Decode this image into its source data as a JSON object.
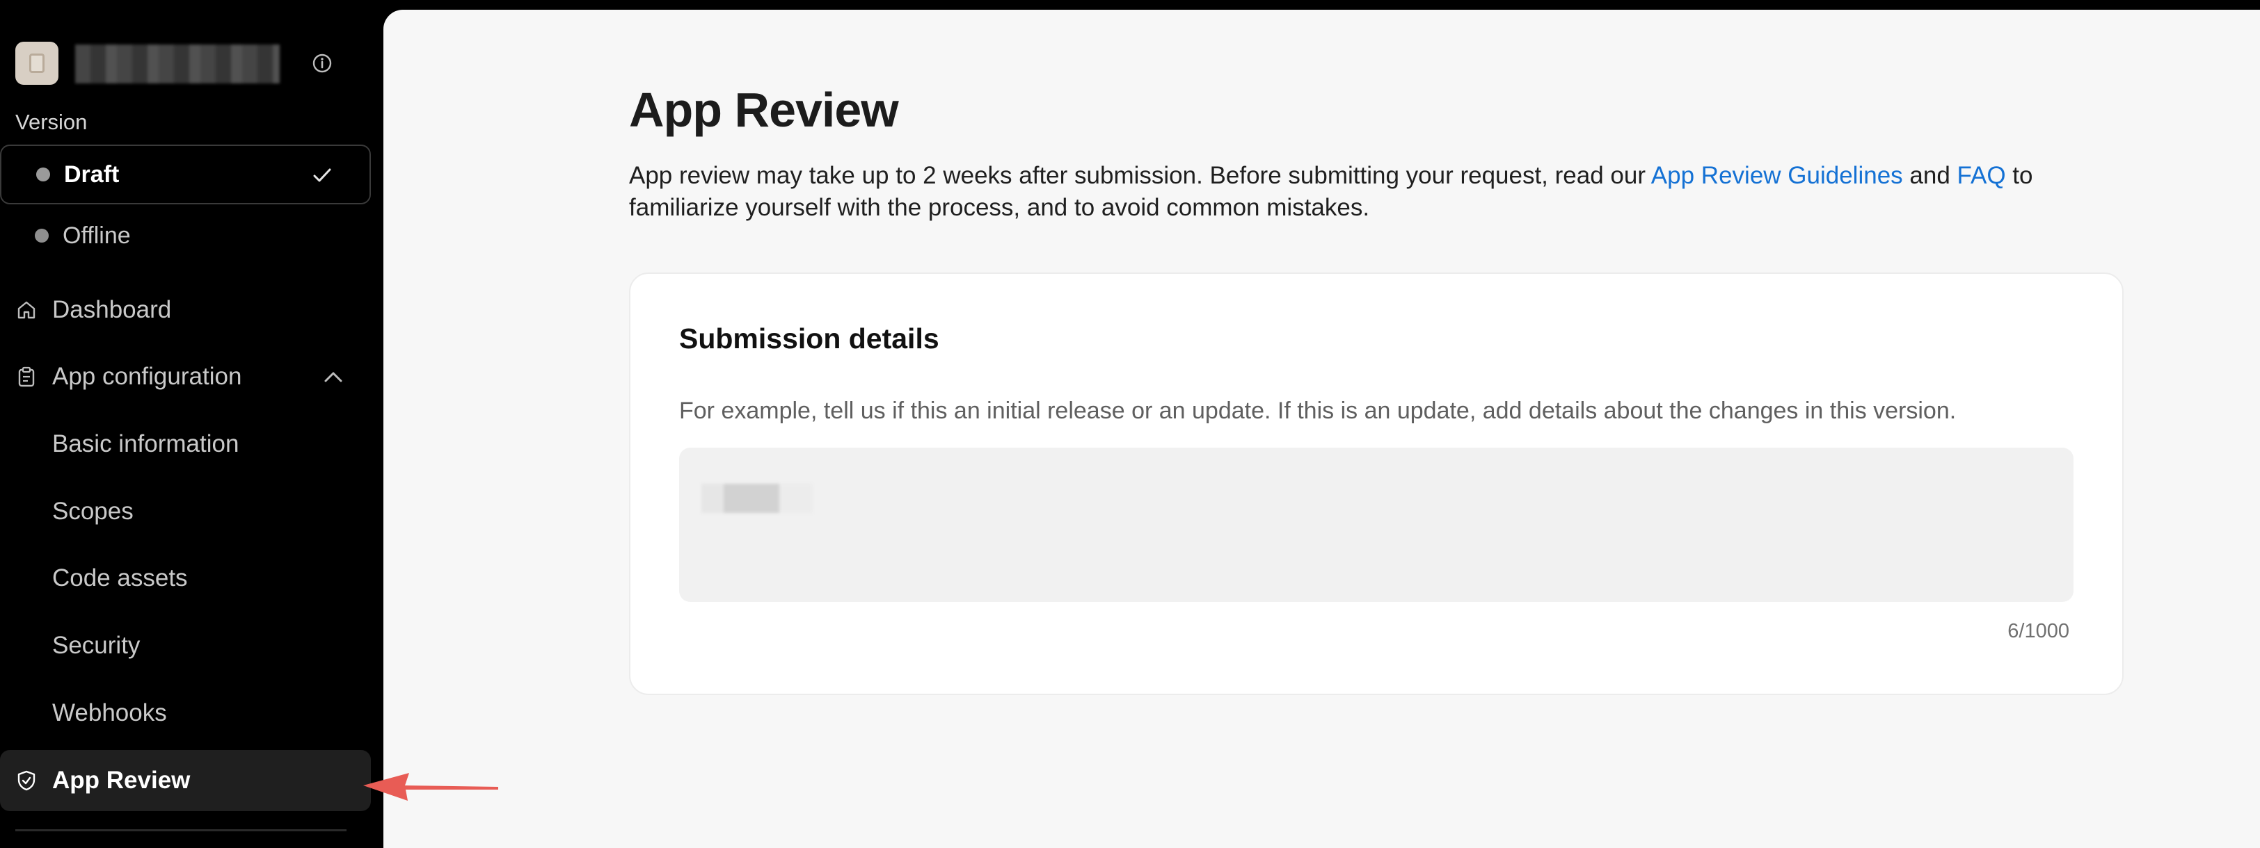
{
  "sidebar": {
    "app_avatar_icon": "app-logo",
    "info_icon": "info-icon",
    "version_label": "Version",
    "versions": [
      {
        "label": "Draft",
        "selected": true
      },
      {
        "label": "Offline",
        "selected": false
      }
    ],
    "nav": {
      "dashboard": "Dashboard",
      "app_configuration": "App configuration",
      "basic_information": "Basic information",
      "scopes": "Scopes",
      "code_assets": "Code assets",
      "security": "Security",
      "webhooks": "Webhooks",
      "app_review": "App Review"
    }
  },
  "main": {
    "title": "App Review",
    "description": {
      "before": "App review may take up to 2 weeks after submission. Before submitting your request, read our ",
      "link1": "App Review Guidelines",
      "middle": " and ",
      "link2": "FAQ",
      "after": " to familiarize yourself with the process, and to avoid common mistakes."
    },
    "card": {
      "title": "Submission details",
      "help": "For example, tell us if this an initial release or an update. If this is an update, add details about the changes in this version.",
      "char_count": "6/1000"
    }
  },
  "colors": {
    "sidebar_bg": "#000000",
    "main_bg": "#f7f7f7",
    "link": "#1471d4",
    "arrow": "#e85c55"
  }
}
